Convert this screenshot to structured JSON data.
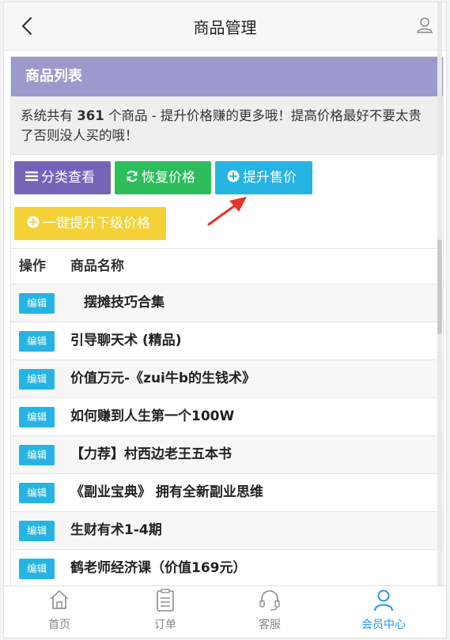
{
  "header": {
    "title": "商品管理"
  },
  "panel": {
    "heading": "商品列表",
    "desc_prefix": "系统共有 ",
    "count": "361",
    "desc_suffix": " 个商品 - 提升价格赚的更多哦！提高价格最好不要太贵了否则没人买的哦！"
  },
  "buttons": {
    "category": "分类查看",
    "restore": "恢复价格",
    "raise": "提升售价",
    "raise_lower": "一键提升下级价格"
  },
  "table": {
    "col_action": "操作",
    "col_name": "商品名称",
    "edit_label": "编辑",
    "rows": [
      "　摆摊技巧合集",
      "引导聊天术 (精品)",
      "价值万元-《zui牛b的生钱术》",
      "如何赚到人生第一个100W",
      "【力荐】村西边老王五本书",
      "《副业宝典》 拥有全新副业思维",
      "生财有术1-4期",
      "鹤老师经济课（价值169元）"
    ]
  },
  "tabbar": {
    "home": "首页",
    "orders": "订单",
    "service": "客服",
    "member": "会员中心"
  },
  "colors": {
    "panel_head": "#9c9acc",
    "btn_purple": "#7565b9",
    "btn_green": "#2dbd5b",
    "btn_blue": "#26b4e3",
    "btn_yellow": "#f4d136",
    "active_tab": "#2196f3",
    "arrow": "#e8332a"
  },
  "icons": [
    "back-arrow-icon",
    "user-icon",
    "list-icon",
    "refresh-icon",
    "plus-circle-icon",
    "home-icon",
    "clipboard-icon",
    "headset-icon",
    "member-icon"
  ]
}
